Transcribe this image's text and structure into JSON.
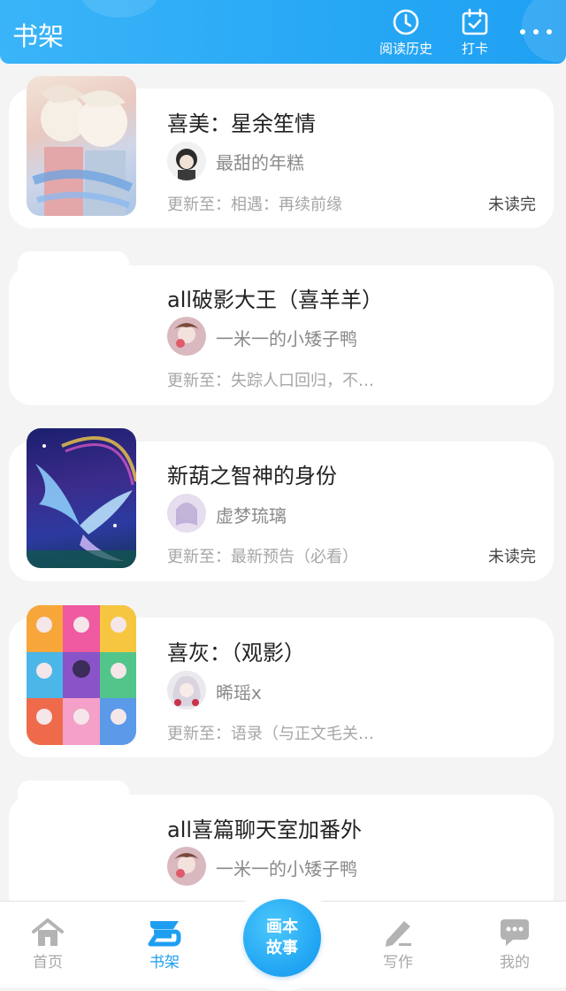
{
  "header": {
    "title": "书架",
    "history_label": "阅读历史",
    "checkin_label": "打卡",
    "accent": "#27a8f5"
  },
  "books": [
    {
      "title": "喜美：星余笙情",
      "author": "最甜的年糕",
      "update": "更新至：相遇：再续前缘",
      "status": "未读完"
    },
    {
      "title": "all破影大王（喜羊羊）",
      "author": "一米一的小矮子鸭",
      "update": "更新至：失踪人口回归，不…",
      "status": ""
    },
    {
      "title": "新葫之智神的身份",
      "author": "虚梦琉璃",
      "update": "更新至：最新预告（必看）",
      "status": "未读完"
    },
    {
      "title": "喜灰：（观影）",
      "author": "晞瑶x",
      "update": "更新至：语录（与正文毛关…",
      "status": ""
    },
    {
      "title": "all喜篇聊天室加番外",
      "author": "一米一的小矮子鸭",
      "update": "",
      "status": ""
    }
  ],
  "nav": {
    "home": "首页",
    "shelf": "书架",
    "center_line1": "画本",
    "center_line2": "故事",
    "write": "写作",
    "mine": "我的",
    "active": "shelf"
  }
}
